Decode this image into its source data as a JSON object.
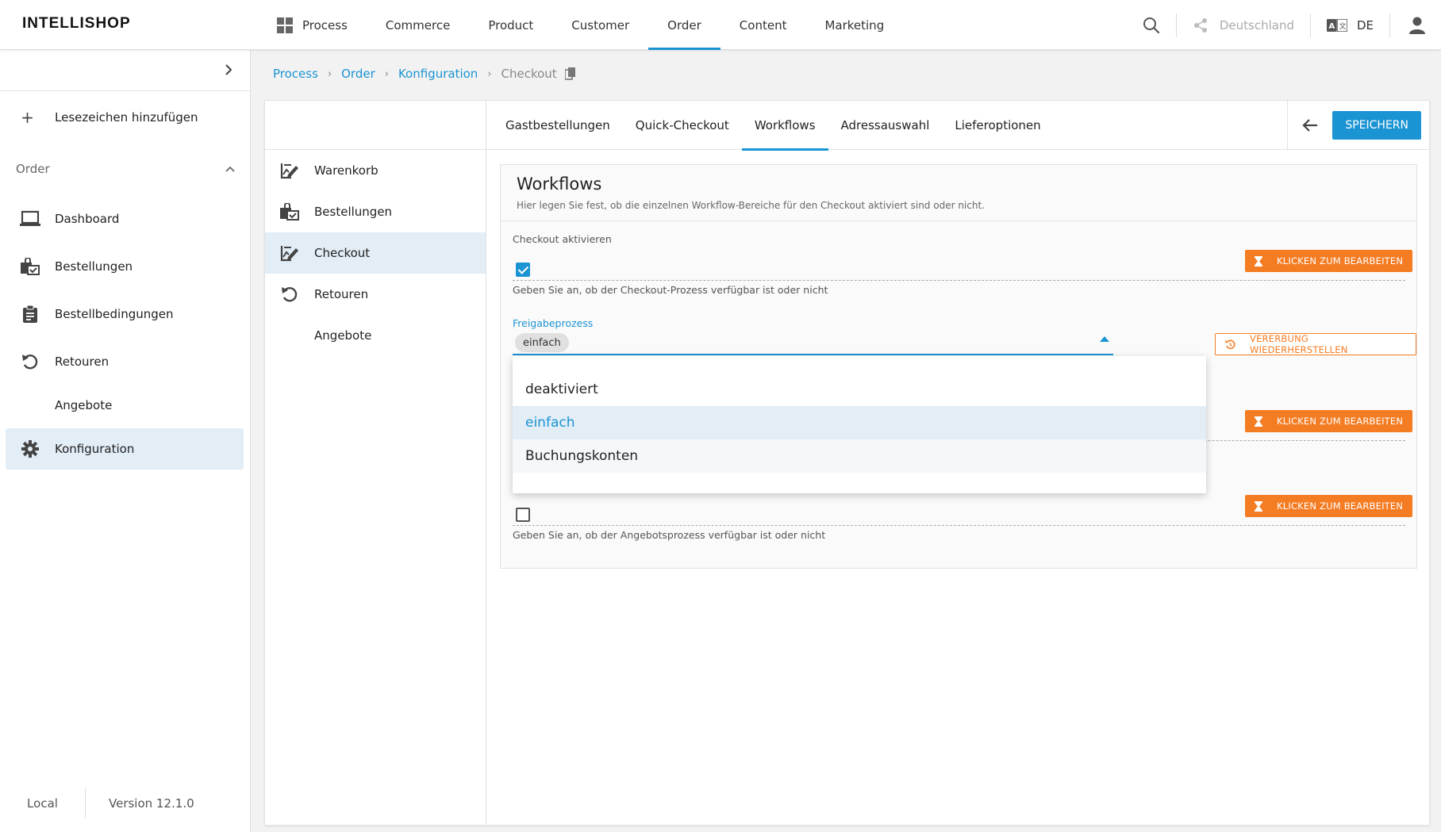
{
  "app": {
    "logo": "INTELLISHOP"
  },
  "mainnav": [
    {
      "label": "Process",
      "active": false
    },
    {
      "label": "Commerce",
      "active": false
    },
    {
      "label": "Product",
      "active": false
    },
    {
      "label": "Customer",
      "active": false
    },
    {
      "label": "Order",
      "active": true
    },
    {
      "label": "Content",
      "active": false
    },
    {
      "label": "Marketing",
      "active": false
    }
  ],
  "topright": {
    "country": "Deutschland",
    "language": "DE"
  },
  "sidebar": {
    "bookmark_label": "Lesezeichen hinzufügen",
    "section_label": "Order",
    "items": [
      {
        "label": "Dashboard",
        "icon": "laptop-icon"
      },
      {
        "label": "Bestellungen",
        "icon": "orders-bag-icon"
      },
      {
        "label": "Bestellbedingungen",
        "icon": "clipboard-icon"
      },
      {
        "label": "Retouren",
        "icon": "undo-icon"
      },
      {
        "label": "Angebote",
        "icon": ""
      },
      {
        "label": "Konfiguration",
        "icon": "gear-icon",
        "active": true
      }
    ],
    "footer": {
      "environment": "Local",
      "version": "Version 12.1.0"
    }
  },
  "breadcrumb": {
    "items": [
      "Process",
      "Order",
      "Konfiguration"
    ],
    "current": "Checkout"
  },
  "inner_nav": [
    {
      "label": "Warenkorb",
      "icon": "edit-chart-icon"
    },
    {
      "label": "Bestellungen",
      "icon": "orders-bag-icon"
    },
    {
      "label": "Checkout",
      "icon": "edit-chart-icon",
      "active": true
    },
    {
      "label": "Retouren",
      "icon": "undo-icon"
    },
    {
      "label": "Angebote",
      "icon": ""
    }
  ],
  "tabs": [
    {
      "label": "Gastbestellungen"
    },
    {
      "label": "Quick-Checkout"
    },
    {
      "label": "Workflows",
      "active": true
    },
    {
      "label": "Adressauswahl"
    },
    {
      "label": "Lieferoptionen"
    }
  ],
  "actions": {
    "save_label": "SPEICHERN"
  },
  "card": {
    "title": "Workflows",
    "description": "Hier legen Sie fest, ob die einzelnen Workflow-Bereiche für den Checkout aktiviert sind oder nicht.",
    "edit_label": "KLICKEN ZUM BEARBEITEN",
    "restore_label": "VERERBUNG WIEDERHERSTELLEN",
    "checkout": {
      "label": "Checkout aktivieren",
      "checked": true,
      "help": "Geben Sie an, ob der Checkout-Prozess verfügbar ist oder nicht"
    },
    "approval": {
      "label": "Freigabeprozess",
      "value": "einfach"
    },
    "offers": {
      "checked": false,
      "help": "Geben Sie an, ob der Angebotsprozess verfügbar ist oder nicht"
    }
  },
  "dropdown": {
    "options": [
      {
        "label": "deaktiviert",
        "state": "normal"
      },
      {
        "label": "einfach",
        "state": "selected"
      },
      {
        "label": "Buchungskonten",
        "state": "hover"
      }
    ]
  },
  "colors": {
    "accent": "#1b94d3",
    "warning": "#f47c23",
    "active_bg": "#e2edf6"
  }
}
